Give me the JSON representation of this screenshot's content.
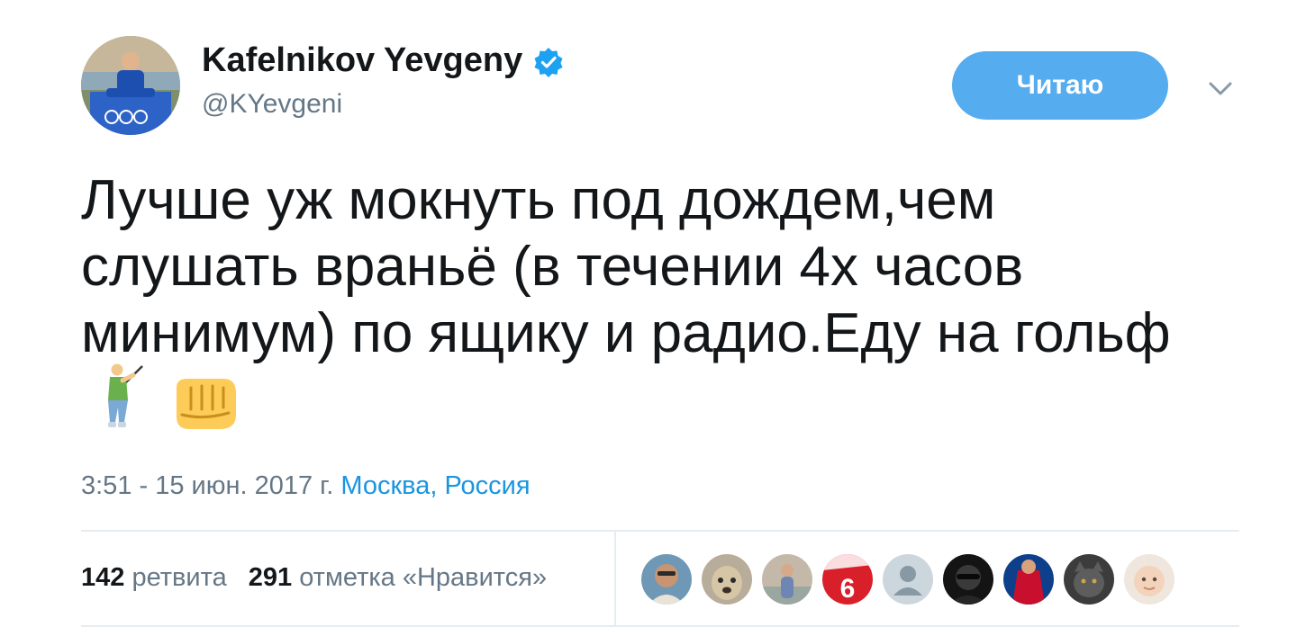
{
  "tweet": {
    "author": {
      "name": "Kafelnikov Yevgeny",
      "handle": "@KYevgeni",
      "verified": true,
      "avatar_icon": "user-avatar"
    },
    "follow_button": {
      "label": "Читаю"
    },
    "menu_icon": "chevron-down-icon",
    "text_lines": [
      "Лучше уж мокнуть под дождем,чем",
      "слушать враньё (в течении 4х часов",
      "минимум) по ящику и радио.Еду на гольф"
    ],
    "emojis": [
      "golfer-emoji",
      "fist-emoji"
    ],
    "timestamp": "3:51 - 15 июн. 2017 г.",
    "location": "Москва, Россия",
    "stats": {
      "retweets_count": "142",
      "retweets_label": "ретвита",
      "likes_count": "291",
      "likes_label": "отметка «Нравится»"
    },
    "likers": [
      {
        "name": "liker-avatar-1"
      },
      {
        "name": "liker-avatar-2"
      },
      {
        "name": "liker-avatar-3"
      },
      {
        "name": "liker-avatar-4",
        "text": "6"
      },
      {
        "name": "liker-avatar-5-default"
      },
      {
        "name": "liker-avatar-6"
      },
      {
        "name": "liker-avatar-7"
      },
      {
        "name": "liker-avatar-8"
      },
      {
        "name": "liker-avatar-9"
      }
    ]
  },
  "colors": {
    "accent": "#55acee",
    "link": "#1b95e0",
    "muted": "#657786",
    "text": "#14171a",
    "divider": "#e6ecf0"
  }
}
